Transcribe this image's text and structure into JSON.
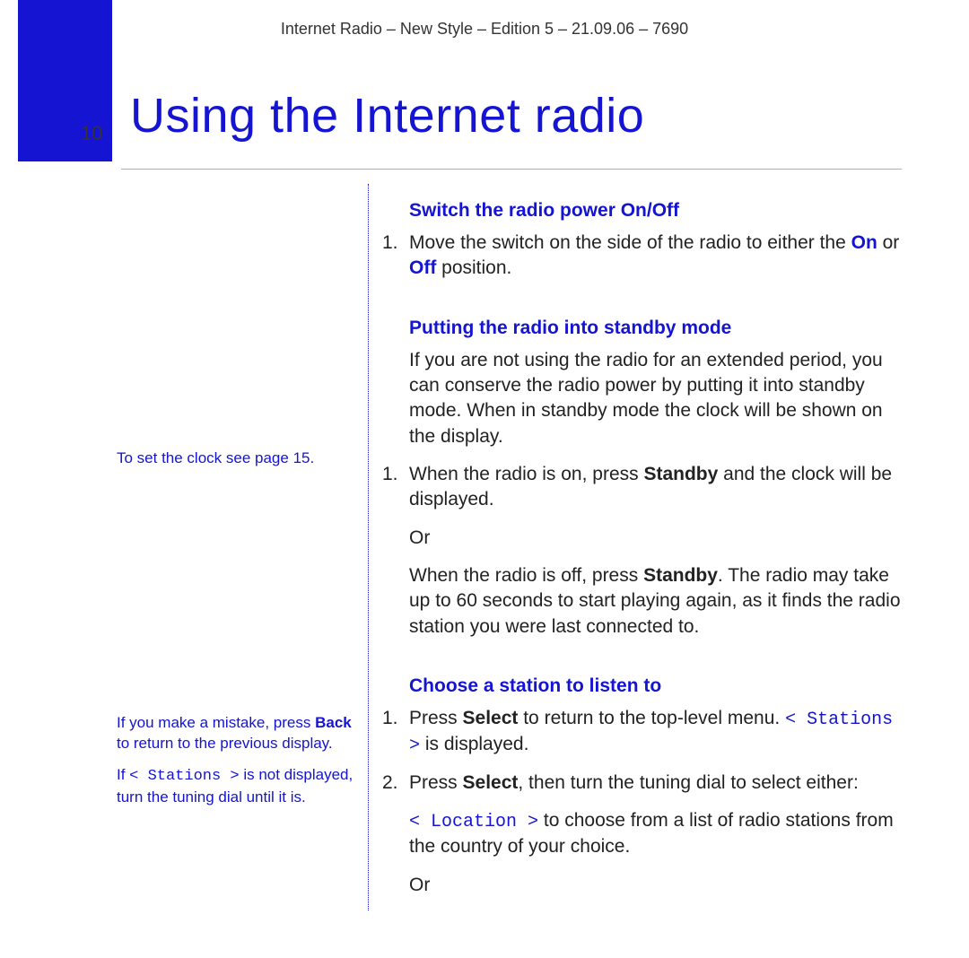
{
  "meta": {
    "top": "Internet Radio – New Style – Edition 5 – 21.09.06 – 7690"
  },
  "page_number": "10",
  "title": "Using the Internet radio",
  "side": {
    "note1": "To set the clock see page 15.",
    "note2_a": "If you make a mistake, press ",
    "note2_bold": "Back",
    "note2_b": " to return to the previous display.",
    "note3_a": "If ",
    "note3_mono": "< Stations >",
    "note3_b": " is not displayed, turn the tuning dial until it is."
  },
  "sections": {
    "s1": {
      "heading": "Switch the radio power On/Off",
      "item1_a": "Move the switch on the side of the radio to either the ",
      "item1_on": "On",
      "item1_or": " or ",
      "item1_off": "Off",
      "item1_b": " position."
    },
    "s2": {
      "heading": "Putting the radio into standby mode",
      "intro": "If you are not using the radio for an extended period, you can conserve the radio power by putting it into standby mode. When in standby mode the clock will be shown on the display.",
      "item1_a": "When the radio is on, press ",
      "item1_bold": "Standby",
      "item1_b": " and the clock will be displayed.",
      "or": "Or",
      "cont_a": "When the radio is off, press ",
      "cont_bold": "Standby",
      "cont_b": ". The radio may take up to 60 seconds to start playing again, as it finds the radio station you were last connected to."
    },
    "s3": {
      "heading": "Choose a station to listen to",
      "item1_a": "Press ",
      "item1_bold": "Select",
      "item1_b": " to return to the top-level menu. ",
      "item1_mono": "< Stations >",
      "item1_c": " is displayed.",
      "item2_a": "Press ",
      "item2_bold": "Select",
      "item2_b": ", then turn the tuning dial to select either:",
      "loc_mono": "< Location >",
      "loc_b": " to choose from a list of radio stations from the country of your choice.",
      "or": "Or"
    }
  }
}
